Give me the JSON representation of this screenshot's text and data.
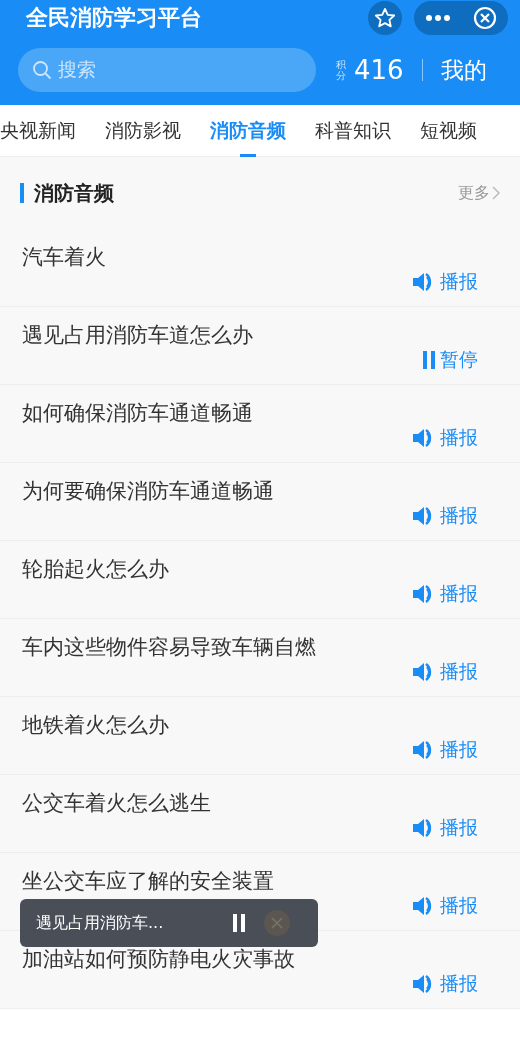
{
  "header": {
    "title": "全民消防学习平台",
    "search": {
      "placeholder": "搜索"
    },
    "points_label": "积分",
    "points": "416",
    "profile_link": "我的"
  },
  "tabs": [
    {
      "label": "央视新闻",
      "selected": false
    },
    {
      "label": "消防影视",
      "selected": false
    },
    {
      "label": "消防音频",
      "selected": true
    },
    {
      "label": "科普知识",
      "selected": false
    },
    {
      "label": "短视频",
      "selected": false
    }
  ],
  "section": {
    "title": "消防音频",
    "more": "更多"
  },
  "items": [
    {
      "title": "汽车着火",
      "action": "播报",
      "playing": false
    },
    {
      "title": "遇见占用消防车道怎么办",
      "action": "暂停",
      "playing": true
    },
    {
      "title": "如何确保消防车通道畅通",
      "action": "播报",
      "playing": false
    },
    {
      "title": "为何要确保消防车通道畅通",
      "action": "播报",
      "playing": false
    },
    {
      "title": "轮胎起火怎么办",
      "action": "播报",
      "playing": false
    },
    {
      "title": "车内这些物件容易导致车辆自燃",
      "action": "播报",
      "playing": false
    },
    {
      "title": "地铁着火怎么办",
      "action": "播报",
      "playing": false
    },
    {
      "title": "公交车着火怎么逃生",
      "action": "播报",
      "playing": false
    },
    {
      "title": "坐公交车应了解的安全装置",
      "action": "播报",
      "playing": false
    },
    {
      "title": "加油站如何预防静电火灾事故",
      "action": "播报",
      "playing": false
    }
  ],
  "mini_player": {
    "title": "遇见占用消防车...",
    "playing": true
  }
}
